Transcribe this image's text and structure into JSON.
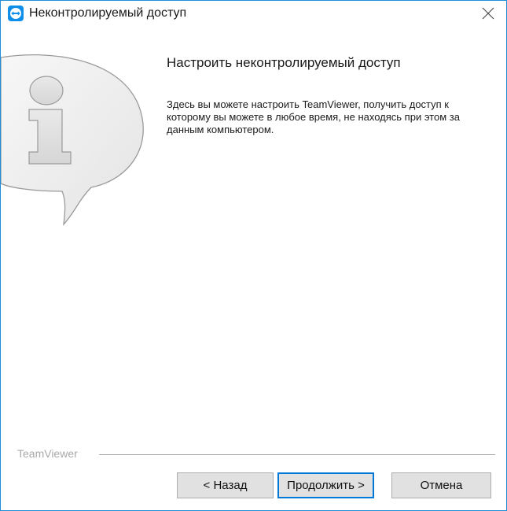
{
  "window": {
    "title": "Неконтролируемый доступ",
    "accent_color": "#1e8fd6"
  },
  "content": {
    "heading": "Настроить неконтролируемый доступ",
    "description": "Здесь вы можете настроить TeamViewer, получить доступ к которому вы можете в любое время, не находясь при этом за данным компьютером.",
    "illustration_icon": "info-speech-bubble-icon"
  },
  "footer": {
    "brand": "TeamViewer",
    "back_label": "< Назад",
    "next_label": "Продолжить >",
    "cancel_label": "Отмена"
  }
}
